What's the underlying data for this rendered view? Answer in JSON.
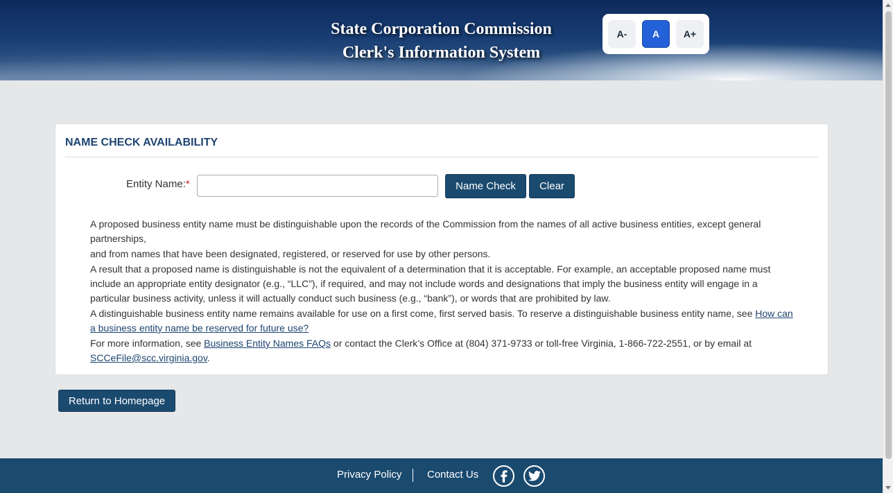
{
  "header": {
    "title_line1": "State Corporation Commission",
    "title_line2": "Clerk's Information System",
    "font_controls": {
      "decrease_label": "A-",
      "default_label": "A",
      "increase_label": "A+",
      "active": "A"
    }
  },
  "card": {
    "title": "NAME CHECK AVAILABILITY",
    "entity_label": "Entity Name:",
    "required_marker": "*",
    "entity_value": "",
    "entity_placeholder": "",
    "name_check_button": "Name Check",
    "clear_button": "Clear",
    "paragraphs": {
      "p1_line1": "A proposed business entity name must be distinguishable upon the records of the Commission from the names of all active business entities, except general partnerships,",
      "p1_line2": "and from names that have been designated, registered, or reserved for use by other persons.",
      "p2": "A result that a proposed name is distinguishable is not the equivalent of a determination that it is acceptable. For example, an acceptable proposed name must include an appropriate entity designator (e.g., “LLC”), if required, and may not include words and designations that imply the business entity will engage in a particular business activity, unless it will actually conduct such business (e.g., “bank”), or words that are prohibited by law.",
      "p3_text": "A distinguishable business entity name remains available for use on a first come, first served basis. To reserve a distinguishable business entity name, see ",
      "p3_link": "How can a business entity name be reserved for future use?",
      "p4_text1": "For more information, see ",
      "p4_link1": "Business Entity Names FAQs",
      "p4_text2": " or contact the Clerk’s Office at (804) 371-9733 or toll-free Virginia, 1-866-722-2551, or by email at ",
      "p4_link2": "SCCeFile@scc.virginia.gov",
      "p4_text3": "."
    }
  },
  "return_button": "Return to Homepage",
  "footer": {
    "privacy_label": "Privacy Policy",
    "contact_label": "Contact Us",
    "social": [
      "facebook-icon",
      "twitter-icon"
    ]
  },
  "colors": {
    "primary_button": "#1b4a6f",
    "title_blue": "#1d4470",
    "active_font_button": "#2361d9",
    "required": "#c0292b"
  }
}
